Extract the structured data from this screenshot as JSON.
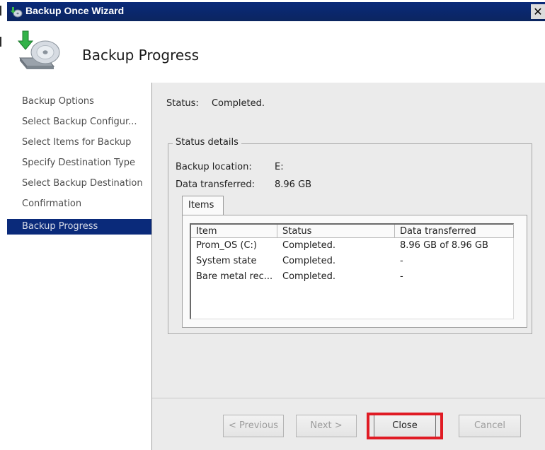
{
  "window": {
    "title": "Backup Once Wizard",
    "close_glyph": "✕"
  },
  "header": {
    "title": "Backup Progress",
    "icon": "backup-disk-icon"
  },
  "sidebar": {
    "items": [
      {
        "label": "Backup Options"
      },
      {
        "label": "Select Backup Configur..."
      },
      {
        "label": "Select Items for Backup"
      },
      {
        "label": "Specify Destination Type"
      },
      {
        "label": "Select Backup Destination"
      },
      {
        "label": "Confirmation"
      },
      {
        "label": "Backup Progress",
        "active": true
      }
    ]
  },
  "main": {
    "status_label": "Status:",
    "status_value": "Completed.",
    "details": {
      "legend": "Status details",
      "location_label": "Backup location:",
      "location_value": "E:",
      "transferred_label": "Data transferred:",
      "transferred_value": "8.96 GB",
      "tab_label": "Items",
      "columns": [
        "Item",
        "Status",
        "Data transferred"
      ],
      "rows": [
        [
          "Prom_OS (C:)",
          "Completed.",
          "8.96 GB of 8.96 GB"
        ],
        [
          "System state",
          "Completed.",
          "-"
        ],
        [
          "Bare metal rec...",
          "Completed.",
          "-"
        ]
      ]
    }
  },
  "buttons": {
    "previous": "< Previous",
    "next": "Next >",
    "close": "Close",
    "cancel": "Cancel"
  },
  "colors": {
    "titlebar": "#0a2a7a",
    "active_item": "#0a2a7a",
    "highlight": "#e01b24"
  }
}
